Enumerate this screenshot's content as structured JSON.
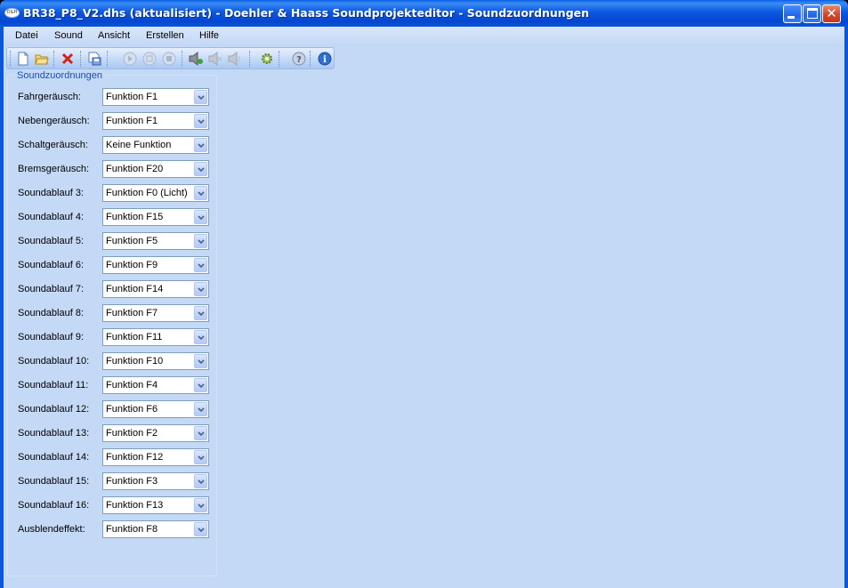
{
  "window": {
    "title": "BR38_P8_V2.dhs (aktualisiert) - Doehler & Haass Soundprojekteditor - Soundzuordnungen",
    "icon_text": "D&H"
  },
  "menu": [
    "Datei",
    "Sound",
    "Ansicht",
    "Erstellen",
    "Hilfe"
  ],
  "toolbar": {
    "icons": [
      "new-file-icon",
      "open-folder-icon",
      "delete-icon",
      "save-as-icon",
      "play-icon",
      "pause-icon",
      "stop-icon",
      "volume-up-icon",
      "volume-mute-icon",
      "volume-icon",
      "settings-gear-icon",
      "help-icon",
      "info-icon"
    ]
  },
  "group": {
    "caption": "Soundzuordnungen",
    "rows": [
      {
        "label": "Fahrgeräusch:",
        "value": "Funktion F1"
      },
      {
        "label": "Nebengeräusch:",
        "value": "Funktion F1"
      },
      {
        "label": "Schaltgeräusch:",
        "value": "Keine Funktion"
      },
      {
        "label": "Bremsgeräusch:",
        "value": "Funktion F20"
      },
      {
        "label": "Soundablauf 3:",
        "value": "Funktion F0 (Licht)"
      },
      {
        "label": "Soundablauf 4:",
        "value": "Funktion F15"
      },
      {
        "label": "Soundablauf 5:",
        "value": "Funktion F5"
      },
      {
        "label": "Soundablauf 6:",
        "value": "Funktion F9"
      },
      {
        "label": "Soundablauf 7:",
        "value": "Funktion F14"
      },
      {
        "label": "Soundablauf 8:",
        "value": "Funktion F7"
      },
      {
        "label": "Soundablauf 9:",
        "value": "Funktion F11"
      },
      {
        "label": "Soundablauf 10:",
        "value": "Funktion F10"
      },
      {
        "label": "Soundablauf 11:",
        "value": "Funktion F4"
      },
      {
        "label": "Soundablauf 12:",
        "value": "Funktion F6"
      },
      {
        "label": "Soundablauf 13:",
        "value": "Funktion F2"
      },
      {
        "label": "Soundablauf 14:",
        "value": "Funktion F12"
      },
      {
        "label": "Soundablauf 15:",
        "value": "Funktion F3"
      },
      {
        "label": "Soundablauf 16:",
        "value": "Funktion F13"
      },
      {
        "label": "Ausblendeffekt:",
        "value": "Funktion F8"
      }
    ]
  },
  "colors": {
    "titlebar": "#0b57e0",
    "client_bg": "#c4d9f6",
    "group_caption": "#1a4fc8"
  }
}
